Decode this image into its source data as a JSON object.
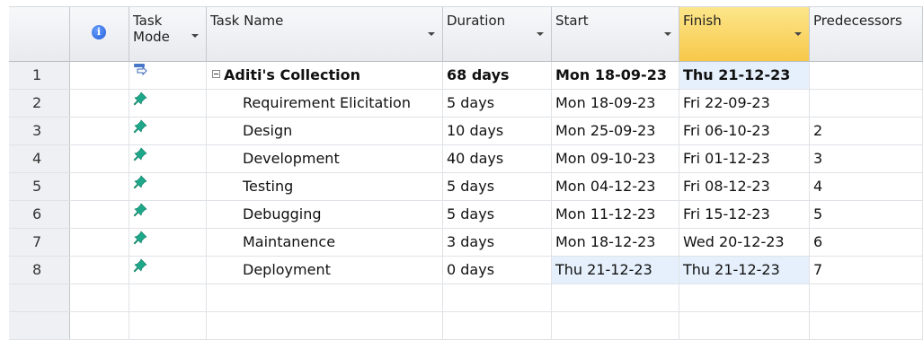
{
  "columns": {
    "task_mode": "Task Mode",
    "task_name": "Task Name",
    "duration": "Duration",
    "start": "Start",
    "finish": "Finish",
    "predecessors": "Predecessors"
  },
  "rows": [
    {
      "id": "1",
      "name": "Aditi's Collection",
      "duration": "68 days",
      "start": "Mon 18-09-23",
      "finish": "Thu 21-12-23",
      "pred": "",
      "summary": true
    },
    {
      "id": "2",
      "name": "Requirement Elicitation",
      "duration": "5 days",
      "start": "Mon 18-09-23",
      "finish": "Fri 22-09-23",
      "pred": ""
    },
    {
      "id": "3",
      "name": "Design",
      "duration": "10 days",
      "start": "Mon 25-09-23",
      "finish": "Fri 06-10-23",
      "pred": "2"
    },
    {
      "id": "4",
      "name": "Development",
      "duration": "40 days",
      "start": "Mon 09-10-23",
      "finish": "Fri 01-12-23",
      "pred": "3"
    },
    {
      "id": "5",
      "name": "Testing",
      "duration": "5 days",
      "start": "Mon 04-12-23",
      "finish": "Fri 08-12-23",
      "pred": "4"
    },
    {
      "id": "6",
      "name": "Debugging",
      "duration": "5 days",
      "start": "Mon 11-12-23",
      "finish": "Fri 15-12-23",
      "pred": "5"
    },
    {
      "id": "7",
      "name": "Maintanence",
      "duration": "3 days",
      "start": "Mon 18-12-23",
      "finish": "Wed 20-12-23",
      "pred": "6"
    },
    {
      "id": "8",
      "name": "Deployment",
      "duration": "0 days",
      "start": "Thu 21-12-23",
      "finish": "Thu 21-12-23",
      "pred": "7"
    }
  ],
  "icons": {
    "info": "info-icon",
    "task_mode_summary": "auto-schedule-icon",
    "task_mode_manual": "pin-icon"
  },
  "colors": {
    "finish_header": "#f7c84a",
    "highlight_cell": "#e5f0fc",
    "pin": "#1ea88a"
  }
}
